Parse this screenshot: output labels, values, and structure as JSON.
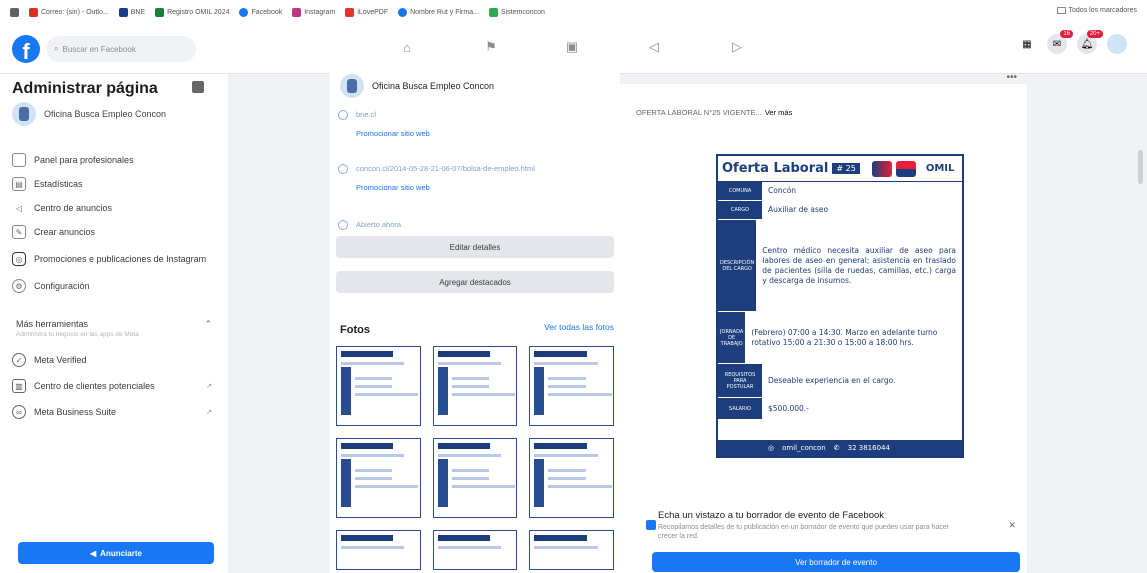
{
  "bookmarks": {
    "items": [
      {
        "label": "",
        "color": "#5f6368"
      },
      {
        "label": "Correo: (sin) - Outlo...",
        "color": "#d93025"
      },
      {
        "label": "BNE",
        "color": "#1a3e8c"
      },
      {
        "label": "Registro OMIL 2024",
        "color": "#188038"
      },
      {
        "label": "Facebook",
        "color": "#1877f2"
      },
      {
        "label": "Instagram",
        "color": "#c13584"
      },
      {
        "label": "iLovePDF",
        "color": "#e5322d"
      },
      {
        "label": "Nombre Rut y Firma...",
        "color": "#1a73e8"
      },
      {
        "label": "Sistemconcon",
        "color": "#34a853"
      }
    ],
    "all_label": "Todos los marcadores"
  },
  "topbar": {
    "logo": "f",
    "search_placeholder": "Buscar en Facebook",
    "badge_messenger": "16",
    "badge_notifications": "20+"
  },
  "sidebar": {
    "title": "Administrar página",
    "page_name": "Oficina Busca Empleo Concon",
    "items": [
      {
        "label": "Panel para profesionales",
        "icon": "dashboard-icon"
      },
      {
        "label": "Estadísticas",
        "icon": "chart-icon"
      },
      {
        "label": "Centro de anuncios",
        "icon": "megaphone-icon"
      },
      {
        "label": "Crear anuncios",
        "icon": "edit-icon"
      },
      {
        "label": "Promociones e publicaciones de Instagram",
        "icon": "instagram-icon"
      },
      {
        "label": "Configuración",
        "icon": "gear-icon"
      }
    ],
    "tools_title": "Más herramientas",
    "tools_sub": "Administra tu negocio en las apps de Meta",
    "tools": [
      {
        "label": "Meta Verified",
        "tail": ""
      },
      {
        "label": "Centro de clientes potenciales",
        "tail": "↗"
      },
      {
        "label": "Meta Business Suite",
        "tail": "↗"
      }
    ],
    "promo_label": "Anunciarte"
  },
  "middle": {
    "page_name": "Oficina Busca Empleo Concon",
    "rows": [
      {
        "text": "bne.cl",
        "link": "Promocionar sitio web"
      },
      {
        "text": "concon.cl/2014-05-28-21-06-07/bolsa-de-empleo.html",
        "link": "Promocionar sitio web"
      },
      {
        "text": "Abierto ahora",
        "link": ""
      }
    ],
    "edit_label": "Editar detalles",
    "featured_label": "Agregar destacados",
    "photos_title": "Fotos",
    "photos_link": "Ver todas las fotos"
  },
  "post": {
    "text": "OFERTA LABORAL N°25 VIGENTE...",
    "more": "Ver más",
    "offer": {
      "title": "Oferta Laboral",
      "number": "# 25",
      "omil": "OMIL",
      "rows": [
        {
          "key": "COMUNA",
          "value": "Concón"
        },
        {
          "key": "CARGO",
          "value": "Auxiliar de aseo"
        },
        {
          "key": "DESCRIPCIÓN DEL CARGO",
          "value": "Centro médico necesita auxiliar de aseo para labores de aseo en general; asistencia en traslado de pacientes (silla de ruedas, camillas, etc.) carga y descarga de insumos."
        },
        {
          "key": "JORNADA DE TRABAJO",
          "value": "(Febrero) 07:00 a 14:30. Marzo en adelante turno rotativo 15:00 a 21:30 o 15:00 a 18:00 hrs."
        },
        {
          "key": "REQUISITOS PARA POSTULAR",
          "value": "Deseable experiencia en el cargo."
        },
        {
          "key": "SALARIO",
          "value": "$500.000.-"
        }
      ],
      "footer_ig": "omil_concon",
      "footer_phone": "32 3816044"
    },
    "draft_title": "Echa un vistazo a tu borrador de evento de Facebook",
    "draft_sub": "Recopilamos detalles de tu publicación en un borrador de evento que puedes usar para hacer crecer la red.",
    "draft_button": "Ver borrador de evento"
  }
}
